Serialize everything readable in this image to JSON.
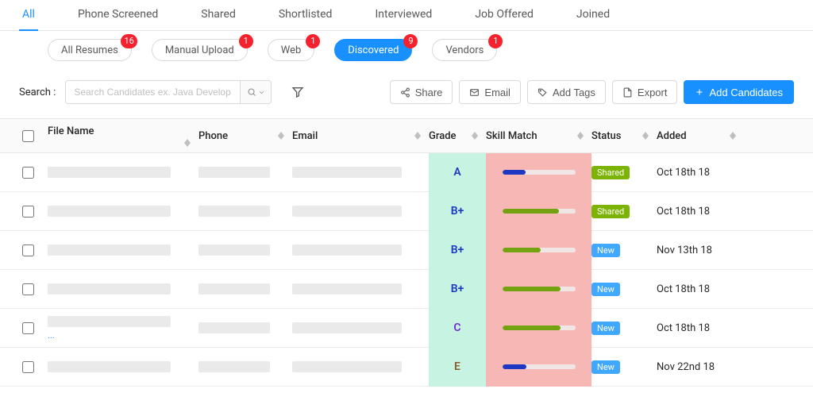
{
  "tabs": [
    {
      "label": "All",
      "active": true
    },
    {
      "label": "Phone Screened"
    },
    {
      "label": "Shared"
    },
    {
      "label": "Shortlisted"
    },
    {
      "label": "Interviewed"
    },
    {
      "label": "Job Offered"
    },
    {
      "label": "Joined"
    }
  ],
  "pills": [
    {
      "label": "All Resumes",
      "count": 16
    },
    {
      "label": "Manual Upload",
      "count": 1
    },
    {
      "label": "Web",
      "count": 1
    },
    {
      "label": "Discovered",
      "count": 9,
      "active": true
    },
    {
      "label": "Vendors",
      "count": 1
    }
  ],
  "search": {
    "label": "Search :",
    "placeholder": "Search Candidates ex. Java Develop"
  },
  "actions": {
    "share": "Share",
    "email": "Email",
    "addTags": "Add Tags",
    "export": "Export",
    "addCandidates": "Add Candidates"
  },
  "columns": {
    "file": "File Name",
    "phone": "Phone",
    "email": "Email",
    "grade": "Grade",
    "skill": "Skill Match",
    "status": "Status",
    "added": "Added"
  },
  "rows": [
    {
      "grade": "A",
      "gradeColor": "#1d39c4",
      "skill": 32,
      "skillColor": "#1d39c4",
      "status": "Shared",
      "statusColor": "#7cb305",
      "added": "Oct 18th 18",
      "ellipsis": false
    },
    {
      "grade": "B+",
      "gradeColor": "#1d39c4",
      "skill": 78,
      "skillColor": "#73a311",
      "status": "Shared",
      "statusColor": "#7cb305",
      "added": "Oct 18th 18",
      "ellipsis": false
    },
    {
      "grade": "B+",
      "gradeColor": "#1d39c4",
      "skill": 53,
      "skillColor": "#73a311",
      "status": "New",
      "statusColor": "#40a9ff",
      "added": "Nov 13th 18",
      "ellipsis": false
    },
    {
      "grade": "B+",
      "gradeColor": "#1d39c4",
      "skill": 80,
      "skillColor": "#73a311",
      "status": "New",
      "statusColor": "#40a9ff",
      "added": "Oct 18th 18",
      "ellipsis": false
    },
    {
      "grade": "C",
      "gradeColor": "#722ed1",
      "skill": 80,
      "skillColor": "#73a311",
      "status": "New",
      "statusColor": "#40a9ff",
      "added": "Oct 18th 18",
      "ellipsis": true,
      "ellipsisText": "..."
    },
    {
      "grade": "E",
      "gradeColor": "#8b5a2b",
      "skill": 33,
      "skillColor": "#1d39c4",
      "status": "New",
      "statusColor": "#40a9ff",
      "added": "Nov 22nd 18",
      "ellipsis": false
    }
  ]
}
